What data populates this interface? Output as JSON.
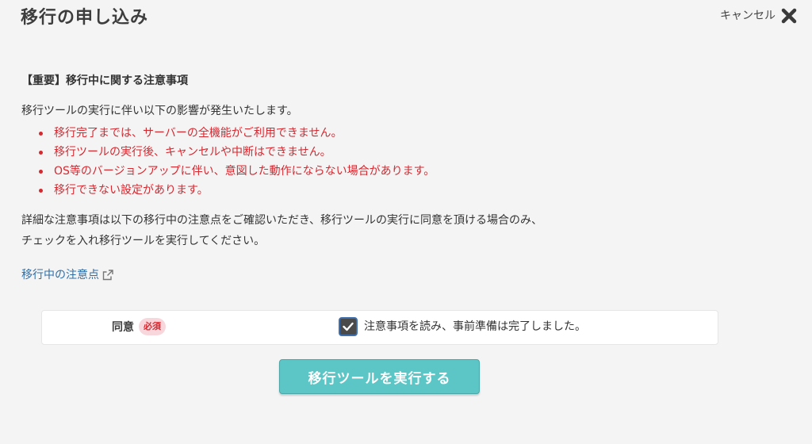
{
  "header": {
    "title": "移行の申し込み",
    "cancel_label": "キャンセル"
  },
  "notice": {
    "heading": "【重要】移行中に関する注意事項",
    "intro": "移行ツールの実行に伴い以下の影響が発生いたします。",
    "warnings": [
      "移行完了までは、サーバーの全機能がご利用できません。",
      "移行ツールの実行後、キャンセルや中断はできません。",
      "OS等のバージョンアップに伴い、意図した動作にならない場合があります。",
      "移行できない設定があります。"
    ],
    "details_line1": "詳細な注意事項は以下の移行中の注意点をご確認いただき、移行ツールの実行に同意を頂ける場合のみ、",
    "details_line2": "チェックを入れ移行ツールを実行してください。",
    "link_label": "移行中の注意点"
  },
  "agreement": {
    "label": "同意",
    "required_badge": "必須",
    "checkbox_label": "注意事項を読み、事前準備は完了しました。",
    "checked": true
  },
  "actions": {
    "run_label": "移行ツールを実行する"
  },
  "colors": {
    "warning": "#d6282f",
    "link": "#2f6fa8",
    "primary_button": "#5cc6c6",
    "background": "#f4f4f5"
  }
}
